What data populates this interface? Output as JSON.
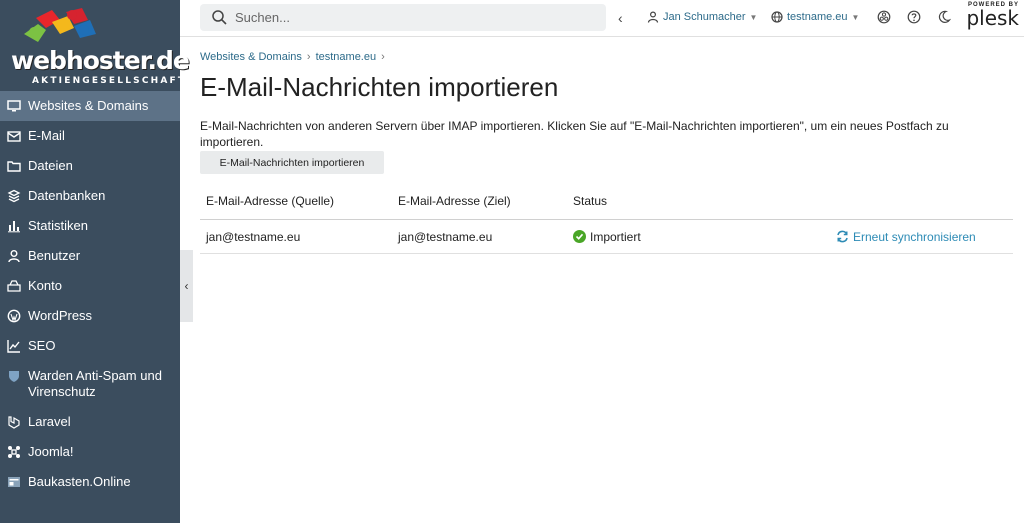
{
  "brand": {
    "logo_main": "webhoster.de",
    "logo_sub": "AKTIENGESELLSCHAFT",
    "powered_by": "POWERED BY",
    "plesk": "plesk"
  },
  "sidebar": {
    "items": [
      {
        "label": "Websites & Domains",
        "icon": "monitor-icon",
        "active": true
      },
      {
        "label": "E-Mail",
        "icon": "mail-icon"
      },
      {
        "label": "Dateien",
        "icon": "folder-icon"
      },
      {
        "label": "Datenbanken",
        "icon": "database-icon"
      },
      {
        "label": "Statistiken",
        "icon": "bar-chart-icon"
      },
      {
        "label": "Benutzer",
        "icon": "user-icon"
      },
      {
        "label": "Konto",
        "icon": "account-icon"
      },
      {
        "label": "WordPress",
        "icon": "wordpress-icon"
      },
      {
        "label": "SEO",
        "icon": "seo-chart-icon"
      },
      {
        "label": "Warden Anti-Spam und Virenschutz",
        "icon": "shield-icon"
      },
      {
        "label": "Laravel",
        "icon": "laravel-icon"
      },
      {
        "label": "Joomla!",
        "icon": "joomla-icon"
      },
      {
        "label": "Baukasten.Online",
        "icon": "builder-icon"
      }
    ]
  },
  "topbar": {
    "search_placeholder": "Suchen...",
    "user": "Jan Schumacher",
    "domain": "testname.eu"
  },
  "breadcrumb": [
    "Websites & Domains",
    "testname.eu"
  ],
  "page": {
    "title": "E-Mail-Nachrichten importieren",
    "description": "E-Mail-Nachrichten von anderen Servern über IMAP importieren. Klicken Sie auf \"E-Mail-Nachrichten importieren\", um ein neues Postfach zu importieren.",
    "import_button": "E-Mail-Nachrichten importieren"
  },
  "table": {
    "headers": [
      "E-Mail-Adresse (Quelle)",
      "E-Mail-Adresse (Ziel)",
      "Status"
    ],
    "rows": [
      {
        "source": "jan@testname.eu",
        "target": "jan@testname.eu",
        "status": "Importiert",
        "action": "Erneut synchronisieren"
      }
    ]
  },
  "colors": {
    "sidebar_bg": "#3b4d5e",
    "sidebar_active": "#5d7287",
    "link": "#2d6b8a",
    "status_ok": "#4aa627"
  }
}
